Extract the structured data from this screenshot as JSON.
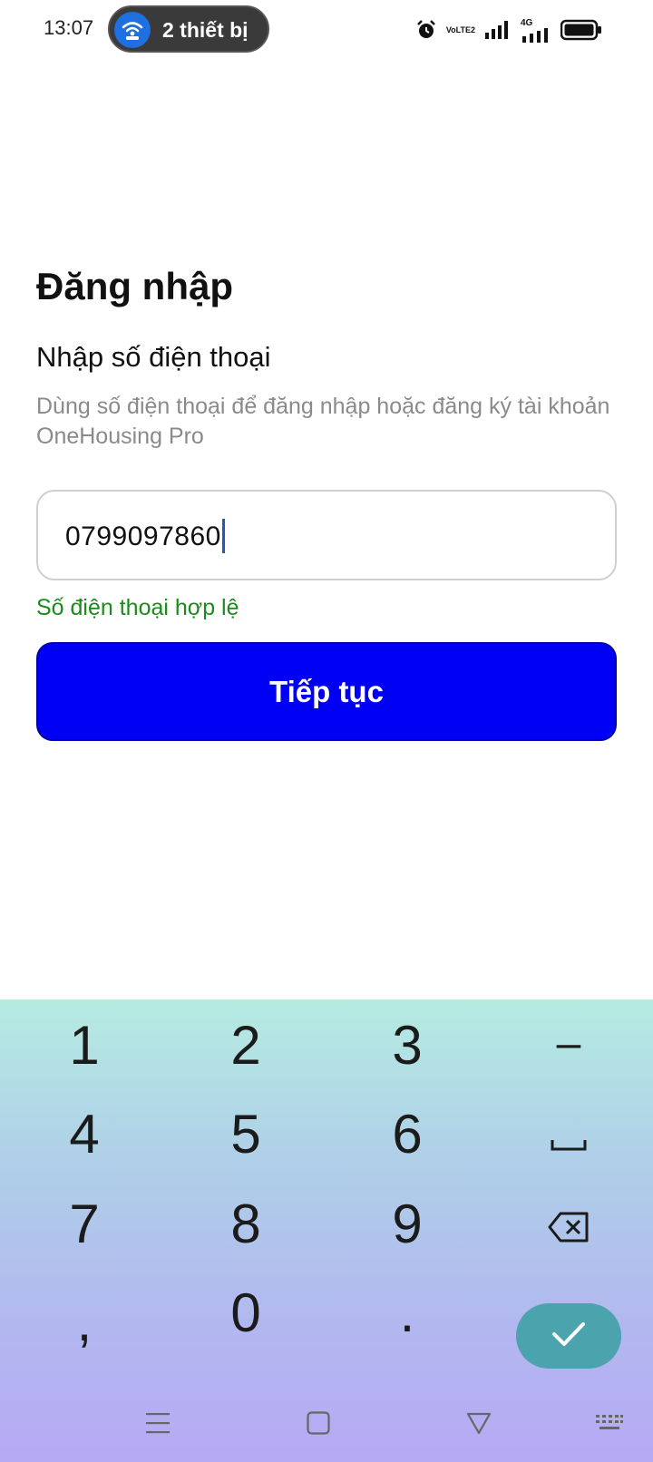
{
  "status_bar": {
    "time": "13:07",
    "hotspot_label": "2 thiết bị",
    "volte_top": "Vo",
    "volte_bottom": "LTE2",
    "network_type": "4G",
    "icons": [
      "alarm-icon",
      "volte-icon",
      "signal-icon",
      "4g-signal-icon",
      "battery-icon"
    ]
  },
  "login": {
    "title": "Đăng nhập",
    "subtitle": "Nhập số điện thoại",
    "description": "Dùng số điện thoại để đăng nhập hoặc đăng ký tài khoản OneHousing Pro",
    "phone_value": "0799097860",
    "validation_message": "Số điện thoại hợp lệ",
    "continue_label": "Tiếp tục"
  },
  "keyboard": {
    "keys": {
      "k1": "1",
      "k2": "2",
      "k3": "3",
      "dash": "–",
      "k4": "4",
      "k5": "5",
      "k6": "6",
      "k7": "7",
      "k8": "8",
      "k9": "9",
      "comma": ",",
      "k0": "0",
      "dot": "."
    },
    "special_icons": [
      "space-icon",
      "backspace-icon",
      "check-icon"
    ]
  },
  "nav_bar": {
    "icons": [
      "menu-icon",
      "home-icon",
      "back-icon",
      "keyboard-icon"
    ]
  },
  "colors": {
    "primary_button": "#0000f5",
    "valid_text": "#1c8a1c",
    "hotspot_blue": "#1e6fe0",
    "confirm_key": "#4aa3ad"
  }
}
